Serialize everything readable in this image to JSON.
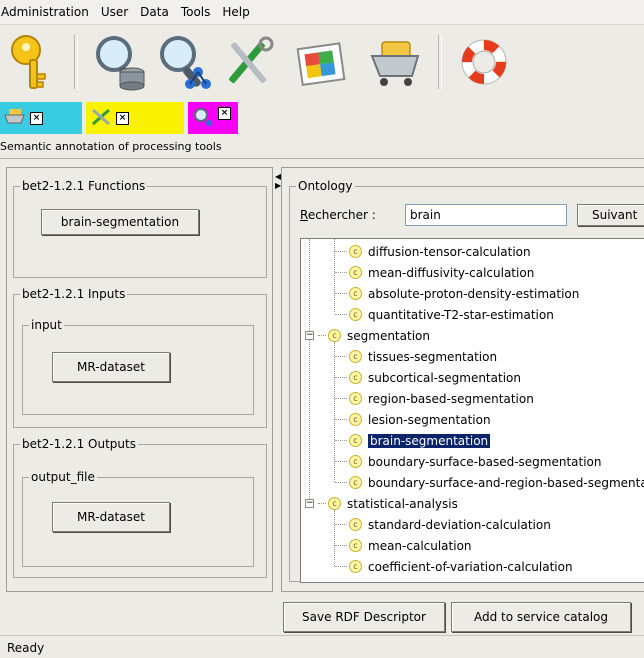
{
  "menu": [
    "Administration",
    "User",
    "Data",
    "Tools",
    "Help"
  ],
  "toolbar": {
    "icons": [
      "key-icon",
      "database-search-icon",
      "network-search-icon",
      "tools-icon",
      "puzzle-icon",
      "cart-icon",
      "lifebuoy-icon"
    ]
  },
  "tabs": [
    {
      "icon": "cart-icon",
      "color": "#38cbe2"
    },
    {
      "icon": "tools-icon",
      "color": "#f9f200"
    },
    {
      "icon": "network-search-icon",
      "color": "#f500f5"
    }
  ],
  "panel_title": "Semantic annotation of processing tools",
  "left": {
    "functions": {
      "legend": "bet2-1.2.1 Functions",
      "button": "brain-segmentation"
    },
    "inputs": {
      "legend": "bet2-1.2.1 Inputs",
      "inner_legend": "input",
      "button": "MR-dataset"
    },
    "outputs": {
      "legend": "bet2-1.2.1 Outputs",
      "inner_legend": "output_file",
      "button": "MR-dataset"
    }
  },
  "ontology": {
    "legend": "Ontology",
    "search_label": "Rechercher :",
    "search_value": "brain",
    "next_button": "Suivant",
    "tree": [
      {
        "label": "diffusion-tensor-calculation",
        "level": 2
      },
      {
        "label": "mean-diffusivity-calculation",
        "level": 2
      },
      {
        "label": "absolute-proton-density-estimation",
        "level": 2
      },
      {
        "label": "quantitative-T2-star-estimation",
        "level": 2
      },
      {
        "label": "segmentation",
        "level": 1
      },
      {
        "label": "tissues-segmentation",
        "level": 2
      },
      {
        "label": "subcortical-segmentation",
        "level": 2
      },
      {
        "label": "region-based-segmentation",
        "level": 2
      },
      {
        "label": "lesion-segmentation",
        "level": 2
      },
      {
        "label": "brain-segmentation",
        "level": 2,
        "selected": true
      },
      {
        "label": "boundary-surface-based-segmentation",
        "level": 2
      },
      {
        "label": "boundary-surface-and-region-based-segmentation",
        "level": 2
      },
      {
        "label": "statistical-analysis",
        "level": 1
      },
      {
        "label": "standard-deviation-calculation",
        "level": 2
      },
      {
        "label": "mean-calculation",
        "level": 2
      },
      {
        "label": "coefficient-of-variation-calculation",
        "level": 2
      }
    ]
  },
  "actions": {
    "save": "Save RDF Descriptor",
    "add": "Add to service catalog"
  },
  "status": "Ready"
}
